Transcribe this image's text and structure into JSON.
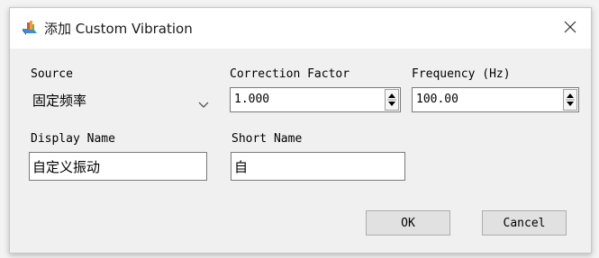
{
  "window": {
    "title": "添加 Custom Vibration",
    "icon": "app-wave-icon",
    "close_icon": "close-icon"
  },
  "form": {
    "source": {
      "label": "Source",
      "value": "固定频率",
      "icon": "chevron-down-icon"
    },
    "correction_factor": {
      "label": "Correction Factor",
      "value": "1.000"
    },
    "frequency": {
      "label": "Frequency (Hz)",
      "value": "100.00"
    },
    "display_name": {
      "label": "Display Name",
      "value": "自定义振动"
    },
    "short_name": {
      "label": "Short Name",
      "value": "自"
    }
  },
  "buttons": {
    "ok_label": "OK",
    "cancel_label": "Cancel"
  },
  "colors": {
    "window_bg": "#ffffff",
    "client_bg": "#f0f0f0",
    "button_bg": "#e1e1e1",
    "border": "#7a7a7a"
  }
}
